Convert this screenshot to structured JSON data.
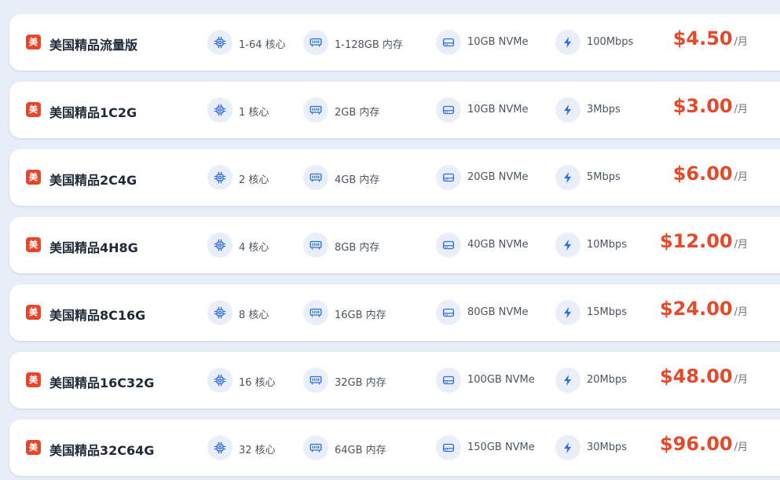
{
  "colors": {
    "background": "#e8eef8",
    "card": "#ffffff",
    "flag": "#e8452b",
    "price": "#e34a2c",
    "icon_bg": "#e9eef8",
    "icon_stroke": "#2f6ee0"
  },
  "flag_glyph": "美",
  "icons": {
    "cpu": "cpu-icon",
    "memory": "memory-icon",
    "disk": "disk-icon",
    "bandwidth": "lightning-icon"
  },
  "price_unit": "/月",
  "plans": [
    {
      "name": "美国精品流量版",
      "cpu": "1-64 核心",
      "memory": "1-128GB 内存",
      "disk": "10GB NVMe",
      "bandwidth": "100Mbps",
      "price": "$4.50"
    },
    {
      "name": "美国精品1C2G",
      "cpu": "1 核心",
      "memory": "2GB 内存",
      "disk": "10GB NVMe",
      "bandwidth": "3Mbps",
      "price": "$3.00"
    },
    {
      "name": "美国精品2C4G",
      "cpu": "2 核心",
      "memory": "4GB 内存",
      "disk": "20GB NVMe",
      "bandwidth": "5Mbps",
      "price": "$6.00"
    },
    {
      "name": "美国精品4H8G",
      "cpu": "4 核心",
      "memory": "8GB 内存",
      "disk": "40GB NVMe",
      "bandwidth": "10Mbps",
      "price": "$12.00"
    },
    {
      "name": "美国精品8C16G",
      "cpu": "8 核心",
      "memory": "16GB 内存",
      "disk": "80GB NVMe",
      "bandwidth": "15Mbps",
      "price": "$24.00"
    },
    {
      "name": "美国精品16C32G",
      "cpu": "16 核心",
      "memory": "32GB 内存",
      "disk": "100GB NVMe",
      "bandwidth": "20Mbps",
      "price": "$48.00"
    },
    {
      "name": "美国精品32C64G",
      "cpu": "32 核心",
      "memory": "64GB 内存",
      "disk": "150GB NVMe",
      "bandwidth": "30Mbps",
      "price": "$96.00"
    }
  ]
}
